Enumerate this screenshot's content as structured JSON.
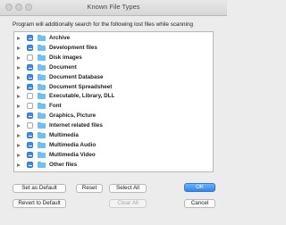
{
  "window": {
    "title": "Known File Types"
  },
  "description": "Program will additionally search for the following lost files while scanning",
  "file_types": [
    {
      "label": "Archive",
      "checked": true
    },
    {
      "label": "Development files",
      "checked": true
    },
    {
      "label": "Disk images",
      "checked": false
    },
    {
      "label": "Document",
      "checked": true
    },
    {
      "label": "Document Database",
      "checked": true
    },
    {
      "label": "Document Spreadsheet",
      "checked": true
    },
    {
      "label": "Executable, Library, DLL",
      "checked": false
    },
    {
      "label": "Font",
      "checked": false
    },
    {
      "label": "Graphics, Picture",
      "checked": true
    },
    {
      "label": "Internet related files",
      "checked": false
    },
    {
      "label": "Multimedia",
      "checked": true
    },
    {
      "label": "Multimedia Audio",
      "checked": true
    },
    {
      "label": "Multimedia Video",
      "checked": true
    },
    {
      "label": "Other files",
      "checked": true
    }
  ],
  "buttons": {
    "set_default": "Set as Default",
    "reset": "Reset",
    "select_all": "Select All",
    "ok": "OK",
    "revert_default": "Revert to Default",
    "clear_all": "Clear All",
    "cancel": "Cancel"
  },
  "colors": {
    "accent": "#3b8cf2",
    "folder": "#6cc0f5"
  }
}
